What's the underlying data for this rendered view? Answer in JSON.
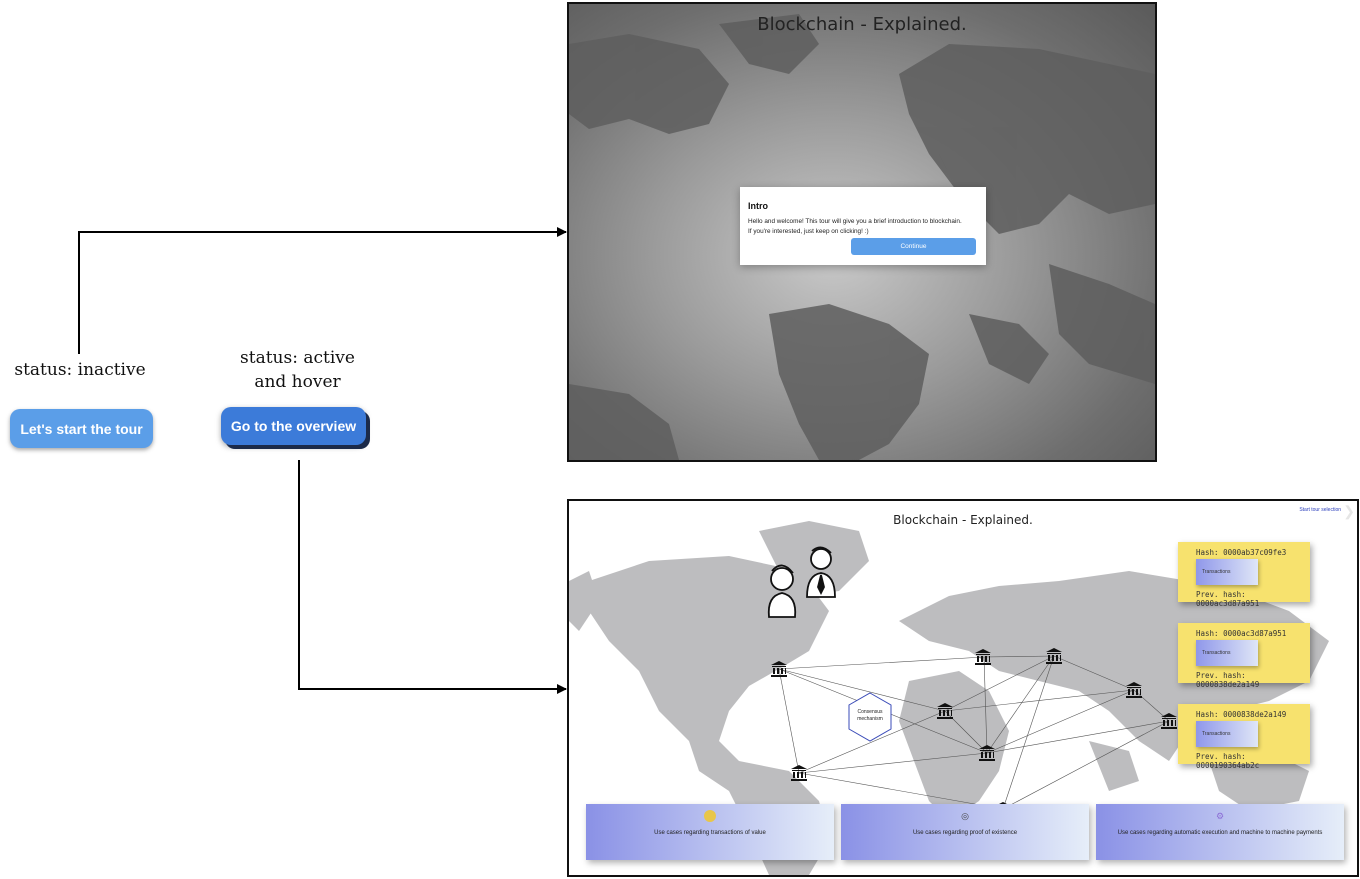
{
  "buttons": {
    "inactive": {
      "status_label_line1": "status: inactive",
      "label": "Let's start the tour"
    },
    "active": {
      "status_label_line1": "status: active",
      "status_label_line2": "and hover",
      "label": "Go to the overview"
    }
  },
  "screens": {
    "intro": {
      "title": "Blockchain - Explained.",
      "dialog": {
        "heading": "Intro",
        "body_line1": "Hello and welcome! This tour will give you a brief introduction to blockchain.",
        "body_line2": "If you're interested, just keep on clicking! :)",
        "continue_label": "Continue"
      }
    },
    "overview": {
      "title": "Blockchain - Explained.",
      "top_right_link": "Start tour selection",
      "consensus_label_line1": "Consensus",
      "consensus_label_line2": "mechanism",
      "blocks": [
        {
          "hash": "Hash: 0000ab37c09fe3",
          "transactions": "Transactions",
          "prev_hash": "Prev. hash: 0000ac3d87a951"
        },
        {
          "hash": "Hash: 0000ac3d87a951",
          "transactions": "Transactions",
          "prev_hash": "Prev. hash: 0000838de2a149"
        },
        {
          "hash": "Hash: 0000838de2a149",
          "transactions": "Transactions",
          "prev_hash": "Prev. hash: 0000190364ab2c"
        }
      ],
      "use_cases": [
        {
          "label": "Use cases regarding transactions of value",
          "icon": "coin-icon",
          "color": "#e8c64a"
        },
        {
          "label": "Use cases regarding proof of existence",
          "icon": "fingerprint-icon",
          "color": "#444444"
        },
        {
          "label": "Use cases regarding automatic execution and machine to machine payments",
          "icon": "gear-icon",
          "color": "#8c6fd6"
        }
      ]
    }
  },
  "colors": {
    "button_inactive": "#5b9ee8",
    "button_active": "#3c7bd9",
    "block_yellow": "#f7e26e",
    "continue_blue": "#5b9ee8"
  }
}
